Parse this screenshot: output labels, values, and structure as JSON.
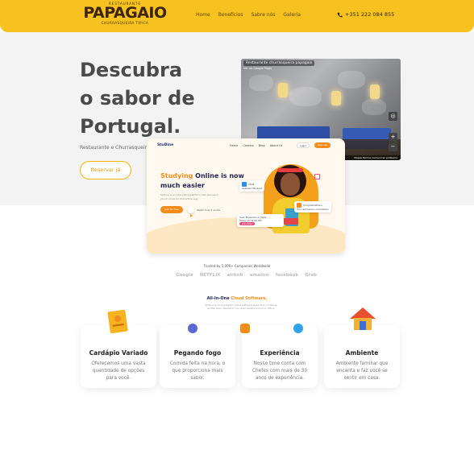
{
  "header": {
    "logo_top": "RESTAURANTE",
    "logo_main": "PAPAGAIO",
    "logo_sub": "CHURRASQUEIRA TÍPICA",
    "nav": [
      "Home",
      "Benefícios",
      "Sabre nós",
      "Galeria"
    ],
    "phone": "+351 222 084 855",
    "phone_icon": "phone-icon",
    "bg_color": "#f7c21f"
  },
  "hero": {
    "title_lines": [
      "Descubra",
      "o sabor de",
      "Portugal."
    ],
    "subtitle": "Restaurante e Churrasqueira",
    "cta": "Reservar já",
    "photo": {
      "caption": "Restaurante churrasqueira papagaio",
      "caption2": "Ver no Google Maps",
      "footer": "Mapas  Termos  Comunicar problema"
    }
  },
  "mock_site": {
    "logo": "StuDine",
    "links": [
      "Home",
      "Careers",
      "Blog",
      "About Us"
    ],
    "login": "Login",
    "signup": "Sign Up",
    "headline_a": "Studying",
    "headline_b": " Online is now",
    "headline_c": "much easier",
    "paragraph": "Skilline is an interesting platform that will teach you in more an interactive way",
    "join": "Join for free",
    "watch": "Watch how it works",
    "chip1_a": "250k",
    "chip1_b": "Assisted Student",
    "chip2_a": "User Experience Class",
    "chip2_b": "Today at 12.00 PM",
    "chip2_btn": "Join Now",
    "chip3_a": "Congratulations",
    "chip3_b": "Your admission completed"
  },
  "trusted": {
    "label": "Trusted by 5,000+ Companies Worldwide",
    "brands": [
      "Google",
      "NETFLIX",
      "airbnb",
      "amazon",
      "facebook",
      "Grab"
    ]
  },
  "all_in_one": {
    "title_a": "All-In-One ",
    "title_b": "Cloud Software.",
    "desc": "Skilline is one powerful online software suite that combines all the tools needed to run a successful school or office."
  },
  "cards": [
    {
      "title": "Cardápio Variado",
      "desc": "Oferecemos uma vasta quantidade de opções para você.",
      "icon": "menu-icon"
    },
    {
      "title": "Pegando fogo",
      "desc": "Comida feita na hora, o que proporciona mais sabor.",
      "icon": "fire-icon"
    },
    {
      "title": "Experiência",
      "desc": "Nosso time conta com Chefes com mais de 30 anos de experiência.",
      "icon": "chef-icon"
    },
    {
      "title": "Ambiente",
      "desc": "Ambiente familiar que encanta e faz você se sentir em casa.",
      "icon": "house-icon"
    }
  ],
  "colors": {
    "accent": "#f7c21f",
    "orange": "#f28c1d",
    "navy": "#1e2350"
  }
}
